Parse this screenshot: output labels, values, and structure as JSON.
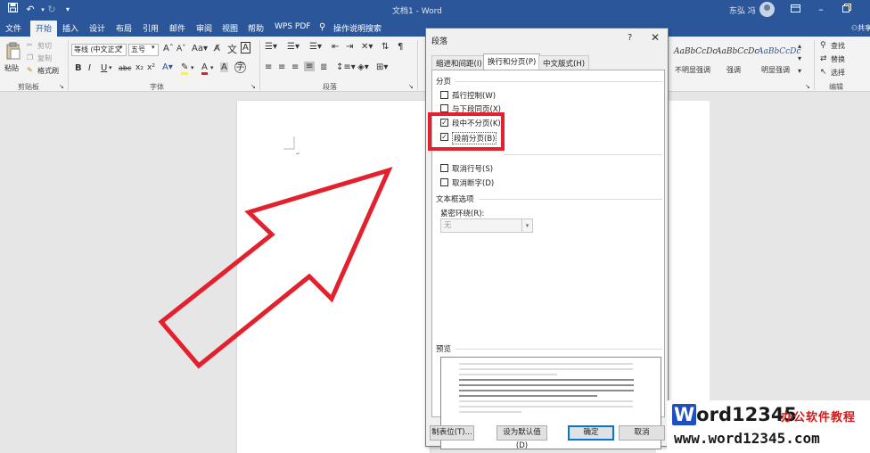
{
  "titlebar": {
    "doc_title": "文档1 - Word",
    "user_name": "东弘 冯",
    "save_icon": "save-icon",
    "undo_icon": "undo-icon",
    "redo_icon": "redo-icon"
  },
  "tabs": [
    {
      "label": "文件"
    },
    {
      "label": "开始"
    },
    {
      "label": "插入"
    },
    {
      "label": "设计"
    },
    {
      "label": "布局"
    },
    {
      "label": "引用"
    },
    {
      "label": "邮件"
    },
    {
      "label": "审阅"
    },
    {
      "label": "视图"
    },
    {
      "label": "帮助"
    },
    {
      "label": "WPS PDF"
    },
    {
      "label": "操作说明搜索"
    }
  ],
  "ribbon": {
    "clipboard": {
      "paste": "粘贴",
      "cut": "剪切",
      "copy": "复制",
      "format_painter": "格式刷",
      "group_label": "剪贴板"
    },
    "font": {
      "font_name": "等线 (中文正文",
      "font_size": "五号",
      "group_label": "字体"
    },
    "paragraph": {
      "group_label": "段落"
    },
    "styles": [
      {
        "sample": "AaBbCcDc",
        "name": "不明显强调"
      },
      {
        "sample": "AaBbCcDc",
        "name": "强调"
      },
      {
        "sample": "AaBbCcDc",
        "name": "明显强调"
      }
    ],
    "editing": {
      "find": "查找",
      "replace": "替换",
      "select": "选择",
      "group_label": "编辑"
    },
    "share_label": "共享"
  },
  "dialog": {
    "title": "段落",
    "help": "?",
    "tabs": [
      {
        "label": "缩进和间距(I)"
      },
      {
        "label": "换行和分页(P)"
      },
      {
        "label": "中文版式(H)"
      }
    ],
    "pagination": {
      "heading": "分页",
      "options": [
        {
          "label": "孤行控制(W)",
          "checked": false
        },
        {
          "label": "与下段同页(X)",
          "checked": false
        },
        {
          "label": "段中不分页(K)",
          "checked": true
        },
        {
          "label": "段前分页(B)",
          "checked": true
        }
      ]
    },
    "formatting_exceptions": {
      "options": [
        {
          "label": "取消行号(S)",
          "checked": false
        },
        {
          "label": "取消断字(D)",
          "checked": false
        }
      ]
    },
    "textbox": {
      "heading": "文本框选项",
      "wrap_label": "紧密环绕(R):",
      "wrap_value": "无"
    },
    "preview": {
      "heading": "预览"
    },
    "buttons": {
      "tabs": "制表位(T)...",
      "set_default": "设为默认值(D)",
      "ok": "确定",
      "cancel": "取消"
    }
  },
  "watermark": {
    "word_prefix": "W",
    "word_rest": "ord12345",
    "slogan": "办公软件教程",
    "url": "www.word12345.com"
  },
  "colors": {
    "title_blue": "#2b579a",
    "annotation_red": "#e3202d"
  }
}
